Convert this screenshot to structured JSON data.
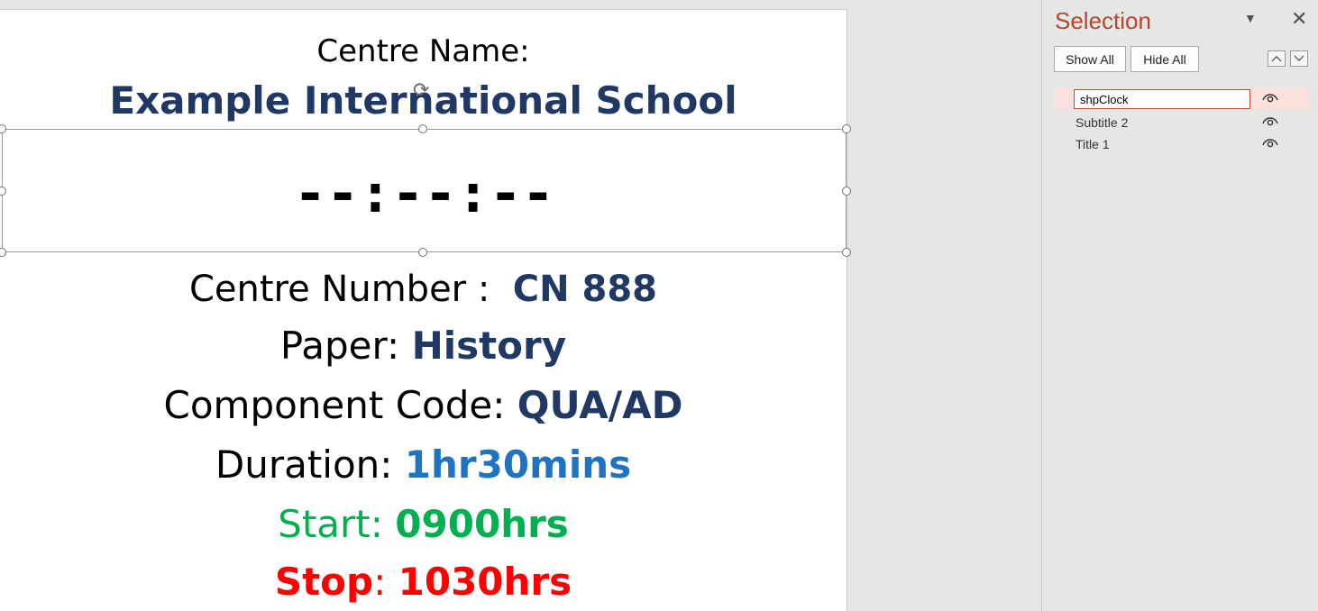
{
  "slide": {
    "centre_name_label": "Centre Name:",
    "school_name": "Example International School",
    "clock": "--:--:--",
    "centre_number": {
      "label": "Centre Number :  ",
      "value": "CN 888"
    },
    "paper": {
      "label": "Paper: ",
      "value": "History"
    },
    "component_code": {
      "label": "Component Code: ",
      "value": "QUA/AD"
    },
    "duration": {
      "label": "Duration: ",
      "value": "1hr30mins"
    },
    "start": {
      "label": "Start",
      "sep": ": ",
      "value": "0900hrs"
    },
    "stop": {
      "label": "Stop",
      "sep": ": ",
      "value": "1030hrs"
    }
  },
  "selection_pane": {
    "title": "Selection",
    "show_all": "Show All",
    "hide_all": "Hide All",
    "items": [
      {
        "name": "shpClock",
        "visible": true,
        "editing": true
      },
      {
        "name": "Subtitle 2",
        "visible": true
      },
      {
        "name": "Title 1",
        "visible": true
      }
    ]
  },
  "colors": {
    "title_blue": "#1f3864",
    "duration_blue": "#1f73c3",
    "start_green": "#00b050",
    "stop_red": "#ff0000",
    "pane_title": "#b7472a"
  }
}
